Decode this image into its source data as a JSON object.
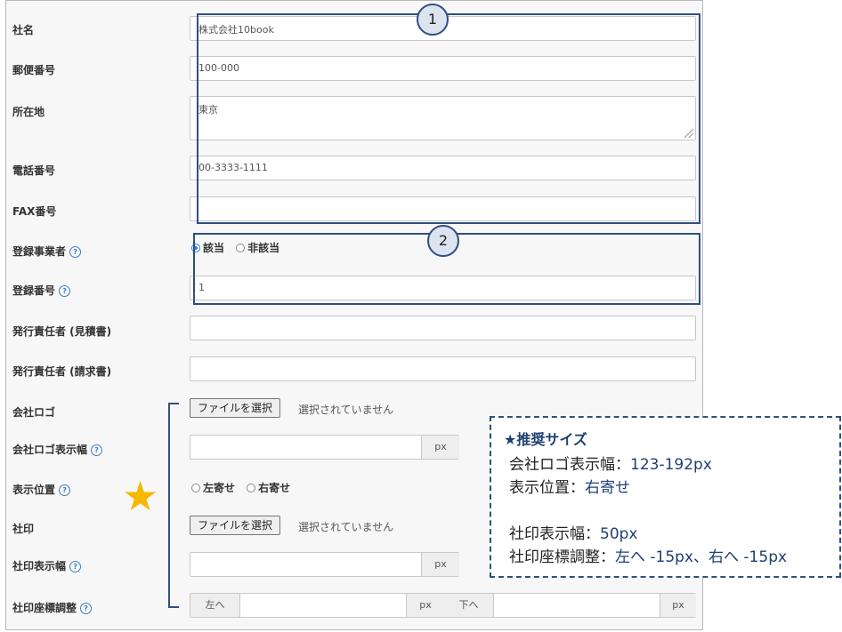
{
  "fields": {
    "company_name": {
      "label": "社名",
      "value": "株式会社10book"
    },
    "postal_code": {
      "label": "郵便番号",
      "value": "100-000"
    },
    "address": {
      "label": "所在地",
      "value": "東京"
    },
    "phone": {
      "label": "電話番号",
      "value": "00-3333-1111"
    },
    "fax": {
      "label": "FAX番号",
      "value": ""
    },
    "registered_business": {
      "label": "登録事業者",
      "help": "?",
      "options": [
        "該当",
        "非該当"
      ],
      "selected": "該当"
    },
    "registration_number": {
      "label": "登録番号",
      "help": "?",
      "value": "1"
    },
    "issuer_estimate": {
      "label": "発行責任者 (見積書)",
      "value": ""
    },
    "issuer_invoice": {
      "label": "発行責任者 (請求書)",
      "value": ""
    },
    "logo": {
      "label": "会社ロゴ",
      "button": "ファイルを選択",
      "status": "選択されていません"
    },
    "logo_width": {
      "label": "会社ロゴ表示幅",
      "help": "?",
      "value": "",
      "unit": "px"
    },
    "position": {
      "label": "表示位置",
      "help": "?",
      "options": [
        "左寄せ",
        "右寄せ"
      ],
      "selected": ""
    },
    "seal": {
      "label": "社印",
      "button": "ファイルを選択",
      "status": "選択されていません"
    },
    "seal_width": {
      "label": "社印表示幅",
      "help": "?",
      "value": "",
      "unit": "px"
    },
    "seal_offset": {
      "label": "社印座標調整",
      "help": "?",
      "left_label": "左へ",
      "down_label": "下へ",
      "unit": "px",
      "left_value": "",
      "down_value": ""
    }
  },
  "annotations": {
    "circle1": "1",
    "circle2": "2",
    "star": "★"
  },
  "note": {
    "title": "★推奨サイズ",
    "logo_width_key": "会社ロゴ表示幅：",
    "logo_width_val": "123-192px",
    "position_key": "表示位置：",
    "position_val": "右寄せ",
    "seal_width_key": "社印表示幅：",
    "seal_width_val": "50px",
    "seal_offset_key": "社印座標調整：",
    "seal_offset_val": "左へ -15px、右へ -15px"
  },
  "colors": {
    "annotation": "#2f4f80",
    "star": "#f5b800",
    "radio_selected": "#2b7de0"
  }
}
